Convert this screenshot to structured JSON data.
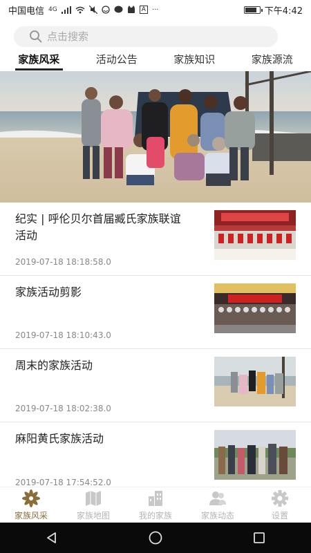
{
  "status_bar": {
    "carrier": "中国电信",
    "network": "4G",
    "time": "下午4:42",
    "battery_level": 0.8,
    "ime_badge": "A",
    "more": "···"
  },
  "search": {
    "placeholder": "点击搜索"
  },
  "tabs": [
    {
      "label": "家族风采",
      "active": true
    },
    {
      "label": "活动公告",
      "active": false
    },
    {
      "label": "家族知识",
      "active": false
    },
    {
      "label": "家族源流",
      "active": false
    }
  ],
  "news": [
    {
      "title": "纪实 | 呼伦贝尔首届臧氏家族联谊活动",
      "date": "2019-07-18 18:18:58.0"
    },
    {
      "title": "家族活动剪影",
      "date": "2019-07-18 18:10:43.0"
    },
    {
      "title": "周末的家族活动",
      "date": "2019-07-18 18:02:38.0"
    },
    {
      "title": "麻阳黄氏家族活动",
      "date": "2019-07-18 17:54:52.0"
    }
  ],
  "bottom_nav": [
    {
      "label": "家族风采",
      "icon": "flower-icon",
      "active": true
    },
    {
      "label": "家族地图",
      "icon": "map-icon",
      "active": false
    },
    {
      "label": "我的家族",
      "icon": "building-icon",
      "active": false
    },
    {
      "label": "家族动态",
      "icon": "people-icon",
      "active": false
    },
    {
      "label": "设置",
      "icon": "gear-icon",
      "active": false
    }
  ],
  "colors": {
    "accent": "#8a6d3b",
    "inactive": "#b5b5b5"
  }
}
